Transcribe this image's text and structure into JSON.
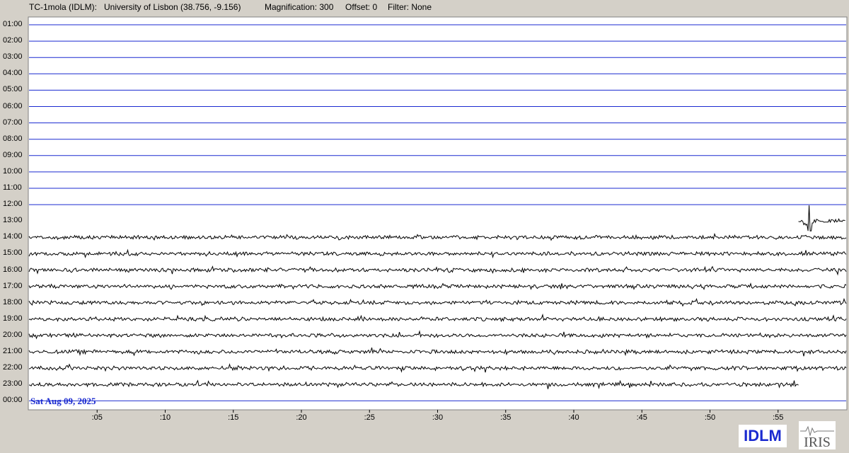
{
  "header": {
    "station": "TC-1mola (IDLM):",
    "location": "University of Lisbon (38.756, -9.156)",
    "magnification": "Magnification: 300",
    "offset": "Offset: 0",
    "filter": "Filter: None"
  },
  "row_labels": [
    "01:00",
    "02:00",
    "03:00",
    "04:00",
    "05:00",
    "06:00",
    "07:00",
    "08:00",
    "09:00",
    "10:00",
    "11:00",
    "12:00",
    "13:00",
    "14:00",
    "15:00",
    "16:00",
    "17:00",
    "18:00",
    "19:00",
    "20:00",
    "21:00",
    "22:00",
    "23:00",
    "00:00"
  ],
  "x_ticks": [
    ":05",
    ":10",
    ":15",
    ":20",
    ":25",
    ":30",
    ":35",
    ":40",
    ":45",
    ":50",
    ":55"
  ],
  "date": "Sat Aug 09, 2025",
  "logos": {
    "idlm": "IDLM",
    "iris": "IRIS"
  },
  "colors": {
    "background": "#d4d0c8",
    "plot_bg": "#ffffff",
    "empty_line": "#1a2ad0",
    "trace": "#000000",
    "date_text": "#1a2ad0"
  },
  "chart_data": {
    "type": "line",
    "title": "",
    "xlabel": "",
    "ylabel": "",
    "x_unit": "minutes past the hour",
    "x_range": [
      0,
      60
    ],
    "rows": [
      {
        "label": "01:00",
        "has_data": false
      },
      {
        "label": "02:00",
        "has_data": false
      },
      {
        "label": "03:00",
        "has_data": false
      },
      {
        "label": "04:00",
        "has_data": false
      },
      {
        "label": "05:00",
        "has_data": false
      },
      {
        "label": "06:00",
        "has_data": false
      },
      {
        "label": "07:00",
        "has_data": false
      },
      {
        "label": "08:00",
        "has_data": false
      },
      {
        "label": "09:00",
        "has_data": false
      },
      {
        "label": "10:00",
        "has_data": false
      },
      {
        "label": "11:00",
        "has_data": false
      },
      {
        "label": "12:00",
        "has_data": false
      },
      {
        "label": "13:00",
        "has_data": true,
        "start_min": 56.5,
        "end_min": 60,
        "event_min": 57.3
      },
      {
        "label": "14:00",
        "has_data": true,
        "start_min": 0,
        "end_min": 60
      },
      {
        "label": "15:00",
        "has_data": true,
        "start_min": 0,
        "end_min": 60
      },
      {
        "label": "16:00",
        "has_data": true,
        "start_min": 0,
        "end_min": 60
      },
      {
        "label": "17:00",
        "has_data": true,
        "start_min": 0,
        "end_min": 60
      },
      {
        "label": "18:00",
        "has_data": true,
        "start_min": 0,
        "end_min": 60
      },
      {
        "label": "19:00",
        "has_data": true,
        "start_min": 0,
        "end_min": 60
      },
      {
        "label": "20:00",
        "has_data": true,
        "start_min": 0,
        "end_min": 60
      },
      {
        "label": "21:00",
        "has_data": true,
        "start_min": 0,
        "end_min": 60
      },
      {
        "label": "22:00",
        "has_data": true,
        "start_min": 0,
        "end_min": 60
      },
      {
        "label": "23:00",
        "has_data": true,
        "start_min": 0,
        "end_min": 56.5
      },
      {
        "label": "00:00",
        "has_data": false
      }
    ]
  }
}
